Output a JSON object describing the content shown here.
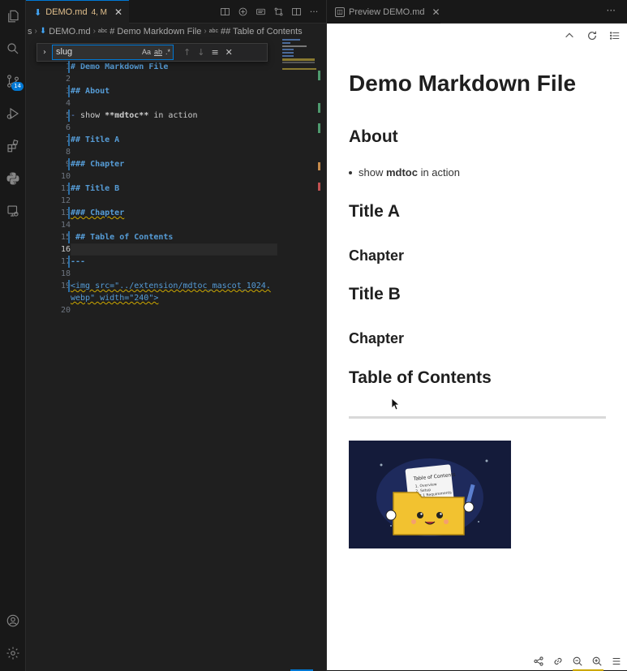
{
  "activity_bar": {
    "items": [
      {
        "icon": "files-icon"
      },
      {
        "icon": "search-icon"
      },
      {
        "icon": "source-control-icon",
        "badge": "14"
      },
      {
        "icon": "run-debug-icon"
      },
      {
        "icon": "extensions-icon"
      },
      {
        "icon": "python-icon"
      },
      {
        "icon": "remote-explorer-icon"
      }
    ],
    "bottom": [
      {
        "icon": "account-icon"
      },
      {
        "icon": "settings-gear-icon"
      }
    ]
  },
  "editor": {
    "tab": {
      "name": "DEMO.md",
      "status": "4, M"
    },
    "breadcrumb": [
      "s",
      "DEMO.md",
      "# Demo Markdown File",
      "## Table of Contents"
    ],
    "find": {
      "query": "slug",
      "opt_case": "Aa",
      "opt_word": "ab",
      "opt_regex": ".*"
    },
    "lines": [
      {
        "n": "1",
        "text": "# Demo Markdown File"
      },
      {
        "n": "2",
        "text": ""
      },
      {
        "n": "3",
        "text": "## About"
      },
      {
        "n": "4",
        "text": ""
      },
      {
        "n": "5",
        "dash": "-",
        "pre": " show ",
        "bold": "**mdtoc**",
        "post": " in action"
      },
      {
        "n": "6",
        "text": ""
      },
      {
        "n": "7",
        "text": "## Title A"
      },
      {
        "n": "8",
        "text": ""
      },
      {
        "n": "9",
        "text": "### Chapter"
      },
      {
        "n": "10",
        "text": ""
      },
      {
        "n": "11",
        "text": "## Title B"
      },
      {
        "n": "12",
        "text": ""
      },
      {
        "n": "13",
        "text": "### Chapter"
      },
      {
        "n": "14",
        "text": ""
      },
      {
        "n": "15",
        "text": " ## Table of Contents"
      },
      {
        "n": "16",
        "text": ""
      },
      {
        "n": "17",
        "text": "---"
      },
      {
        "n": "18",
        "text": ""
      },
      {
        "n": "19",
        "text": "<img src=\"../extension/mdtoc_mascot_1024.",
        "text2": "webp\" width=\"240\">"
      },
      {
        "n": "20",
        "text": ""
      }
    ]
  },
  "preview": {
    "tab": {
      "name": "Preview DEMO.md"
    },
    "h1": "Demo Markdown File",
    "about": "About",
    "li_pre": "show ",
    "li_bold": "mdtoc",
    "li_post": " in action",
    "title_a": "Title A",
    "chapter1": "Chapter",
    "title_b": "Title B",
    "chapter2": "Chapter",
    "toc": "Table of Contents",
    "image": {
      "card_title": "Table of Contents",
      "card_lines": [
        "1. Overview",
        "2. Setup",
        "2.1 Requirements"
      ]
    }
  },
  "colors": {
    "accent": "#0078d4",
    "heading": "#569cd6",
    "modified": "#e2c08d",
    "warning": "#cca700"
  }
}
